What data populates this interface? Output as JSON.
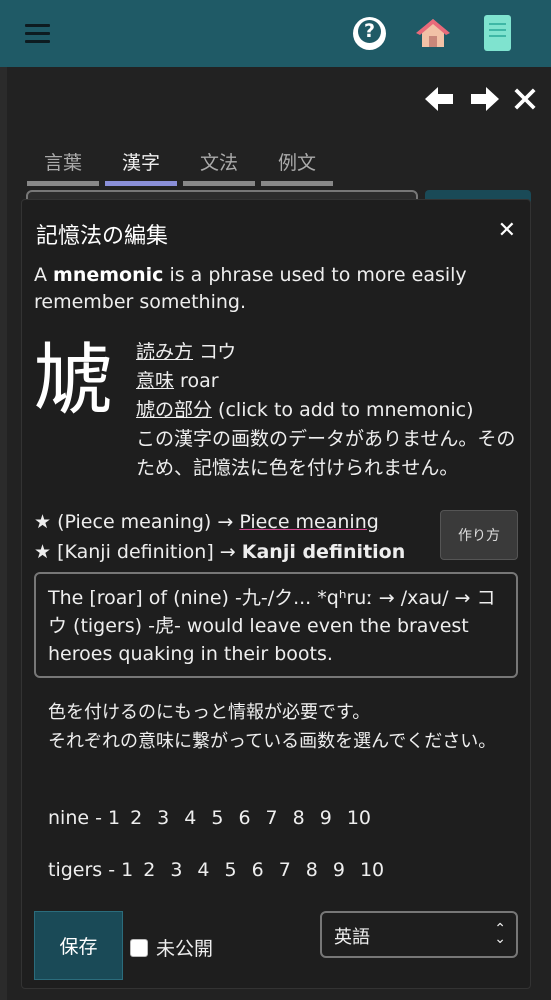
{
  "header": {
    "icons": [
      "hamburger-menu-icon",
      "help-icon",
      "home-icon",
      "book-icon"
    ],
    "accent": "#1f5a66"
  },
  "tabs": [
    {
      "label": "言葉"
    },
    {
      "label": "漢字"
    },
    {
      "label": "文法"
    },
    {
      "label": "例文"
    }
  ],
  "modal": {
    "title": "記憶法の編集",
    "intro_before": "A ",
    "intro_bold": "mnemonic",
    "intro_after": " is a phrase used to more easily remember something.",
    "kanji": "虓",
    "reading_label": "読み方",
    "reading_value": " コウ",
    "meaning_label": "意味",
    "meaning_value": " roar",
    "parts_label": "虓の部分",
    "parts_hint": " (click to add to mnemonic)",
    "no_stroke_data": "この漢字の画数のデータがありません。そのため、記憶法に色を付けられません。",
    "piece_line_prefix": "★ (Piece meaning) → ",
    "piece_line_value": "Piece meaning",
    "kanji_line_prefix": "★ [Kanji definition] → ",
    "kanji_line_value": "Kanji definition",
    "make_button": "作り方",
    "mnemonic_text": "The [roar] of (nine) -九-/ク... *qʰruː → /xau/ → コウ (tigers) -虎- would leave even the bravest heroes quaking in their boots.",
    "info_line1": "色を付けるのにもっと情報が必要です。",
    "info_line2": "それぞれの意味に繋がっている画数を選んでください。",
    "stroke_rows": [
      {
        "label": "nine - 1",
        "numbers": [
          "2",
          "3",
          "4",
          "5",
          "6",
          "7",
          "8",
          "9",
          "10"
        ]
      },
      {
        "label": "tigers - 1",
        "numbers": [
          "2",
          "3",
          "4",
          "5",
          "6",
          "7",
          "8",
          "9",
          "10"
        ]
      }
    ],
    "save_button": "保存",
    "private_label": "未公開",
    "language_selected": "英語"
  }
}
